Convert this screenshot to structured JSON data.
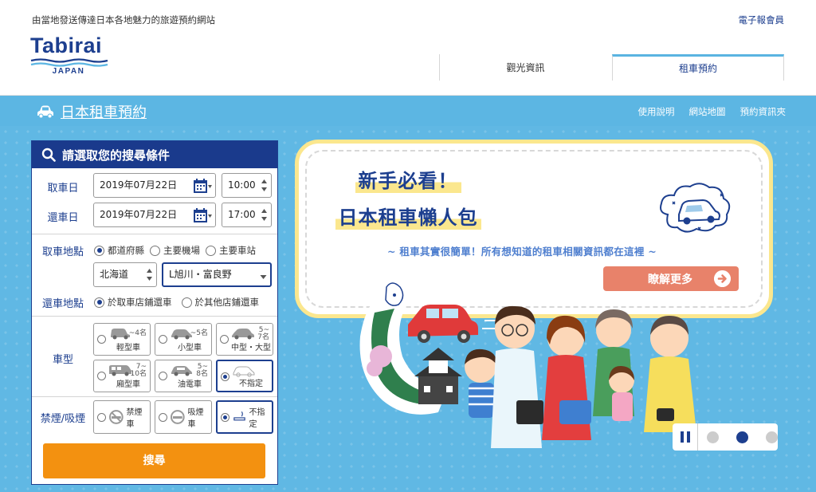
{
  "header": {
    "tagline": "由當地發送傳達日本各地魅力的旅遊預約網站",
    "newsletter": "電子報會員",
    "logo_text": "Tabirai",
    "logo_sub": "JAPAN",
    "tabs": [
      {
        "label": "觀光資訊",
        "active": false
      },
      {
        "label": "租車預約",
        "active": true
      }
    ]
  },
  "band": {
    "title": "日本租車預約",
    "icon": "car-icon",
    "links": [
      "使用說明",
      "網站地圖",
      "預約資訊夾"
    ]
  },
  "search": {
    "title": "請選取您的搜尋條件",
    "pickup_date_label": "取車日",
    "pickup_date": "2019年07月22日",
    "pickup_time": "10:00",
    "return_date_label": "還車日",
    "return_date": "2019年07月22日",
    "return_time": "17:00",
    "pickup_place_label": "取車地點",
    "pickup_place_options": [
      {
        "label": "都道府縣",
        "selected": true
      },
      {
        "label": "主要機場",
        "selected": false
      },
      {
        "label": "主要車站",
        "selected": false
      }
    ],
    "prefecture": "北海道",
    "area": "L旭川・富良野",
    "return_place_label": "還車地點",
    "return_place_options": [
      {
        "label": "於取車店鋪還車",
        "selected": true
      },
      {
        "label": "於其他店鋪還車",
        "selected": false
      }
    ],
    "car_type_label": "車型",
    "car_types": [
      {
        "name": "輕型車",
        "capacity": "~4名",
        "selected": false
      },
      {
        "name": "小型車",
        "capacity": "~5名",
        "selected": false
      },
      {
        "name": "中型・大型",
        "capacity": "5~\n7名",
        "selected": false
      },
      {
        "name": "廂型車",
        "capacity": "7~\n10名",
        "selected": false
      },
      {
        "name": "油電車",
        "capacity": "5~\n8名",
        "selected": false
      },
      {
        "name": "不指定",
        "capacity": "",
        "selected": true
      }
    ],
    "smoking_label": "禁煙/吸煙",
    "smoking_options": [
      {
        "label": "禁煙車",
        "selected": false
      },
      {
        "label": "吸煙車",
        "selected": false
      },
      {
        "label": "不指定",
        "selected": true
      }
    ],
    "search_button": "搜尋"
  },
  "banner": {
    "headline1": "新手必看！",
    "headline2": "日本租車懶人包",
    "subtitle": "~ 租車其實很簡單！所有想知道的租車相關資訊都在這裡 ~",
    "more_button": "瞭解更多",
    "slides_total": 3,
    "slides_active": 2
  },
  "colors": {
    "navy": "#1d3f8f",
    "sky": "#5cb6e3",
    "orange": "#f39110",
    "coral": "#e8826a",
    "yellow": "#fbe78e"
  }
}
